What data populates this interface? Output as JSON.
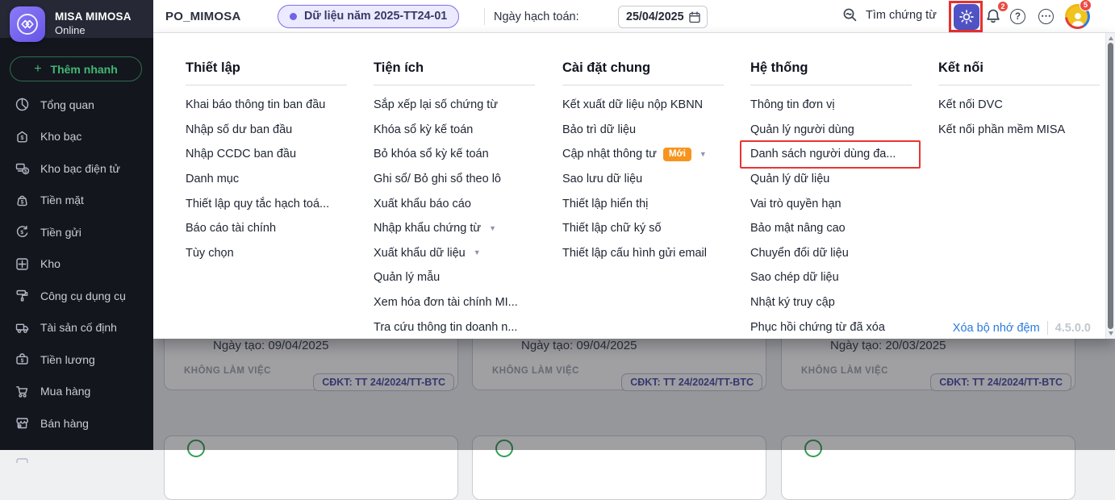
{
  "app": {
    "title": "MISA MIMOSA",
    "subtitle": "Online"
  },
  "colors": {
    "accent_purple": "#7a70ee",
    "gear_background": "#5053c4",
    "highlight_red": "#e93430",
    "notification_red": "#ec4a43",
    "badge_orange": "#f7941d",
    "link_blue": "#2a7ade",
    "success_green": "#2f9e52",
    "quick_add_green": "#40b873",
    "version_gray": "#c2c6ce"
  },
  "sidebar": {
    "quick_add_label": "Thêm nhanh",
    "items": [
      {
        "label": "Tổng quan",
        "icon": "pie-chart"
      },
      {
        "label": "Kho bạc",
        "icon": "treasury-house"
      },
      {
        "label": "Kho bạc điện tử",
        "icon": "e-treasury"
      },
      {
        "label": "Tiền mặt",
        "icon": "cash-purse"
      },
      {
        "label": "Tiền gửi",
        "icon": "deposit-cycle"
      },
      {
        "label": "Kho",
        "icon": "warehouse-grid"
      },
      {
        "label": "Công cụ dụng cụ",
        "icon": "tools-roller"
      },
      {
        "label": "Tài sản cố định",
        "icon": "asset-truck"
      },
      {
        "label": "Tiền lương",
        "icon": "salary-briefcase"
      },
      {
        "label": "Mua hàng",
        "icon": "purchase-cart"
      },
      {
        "label": "Bán hàng",
        "icon": "sales-store"
      }
    ]
  },
  "topbar": {
    "company": "PO_MIMOSA",
    "dataset_pill": "Dữ liệu năm 2025-TT24-01",
    "posting_date_label": "Ngày hạch toán:",
    "posting_date": "25/04/2025",
    "search_label": "Tìm chứng từ",
    "notification_count": "2",
    "profile_count": "5"
  },
  "menu": {
    "new_badge": "Mới",
    "columns": [
      {
        "title": "Thiết lập",
        "items": [
          "Khai báo thông tin ban đầu",
          "Nhập số dư ban đầu",
          "Nhập CCDC ban đầu",
          "Danh mục",
          "Thiết lập quy tắc hạch toá...",
          "Báo cáo tài chính",
          "Tùy chọn"
        ]
      },
      {
        "title": "Tiện ích",
        "items": [
          "Sắp xếp lại số chứng từ",
          "Khóa sổ kỳ kế toán",
          "Bỏ khóa sổ kỳ kế toán",
          "Ghi sổ/ Bỏ ghi sổ theo lô",
          "Xuất khẩu báo cáo",
          "Nhập khẩu chứng từ",
          "Xuất khẩu dữ liệu",
          "Quản lý mẫu",
          "Xem hóa đơn tài chính MI...",
          "Tra cứu thông tin doanh n..."
        ]
      },
      {
        "title": "Cài đặt chung",
        "items": [
          "Kết xuất dữ liệu nộp KBNN",
          "Bảo trì dữ liệu",
          "Cập nhật thông tư",
          "Sao lưu dữ liệu",
          "Thiết lập hiển thị",
          "Thiết lập chữ ký số",
          "Thiết lập cấu hình gửi email"
        ]
      },
      {
        "title": "Hệ thống",
        "items": [
          "Thông tin đơn vị",
          "Quản lý người dùng",
          "Danh sách người dùng đa...",
          "Quản lý dữ liệu",
          "Vai trò quyền hạn",
          "Bảo mật nâng cao",
          "Chuyển đổi dữ liệu",
          "Sao chép dữ liệu",
          "Nhật ký truy cập",
          "Phục hồi chứng từ đã xóa"
        ]
      },
      {
        "title": "Kết nối",
        "items": [
          "Kết nối DVC",
          "Kết nối phần mềm MISA"
        ]
      }
    ],
    "footer": {
      "clear_cache": "Xóa bộ nhớ đệm",
      "version": "4.5.0.0"
    }
  },
  "cards": [
    {
      "created": "Ngày tạo: 09/04/2025",
      "status": "KHÔNG LÀM VIỆC",
      "badge": "CĐKT: TT 24/2024/TT-BTC"
    },
    {
      "created": "Ngày tạo: 09/04/2025",
      "status": "KHÔNG LÀM VIỆC",
      "badge": "CĐKT: TT 24/2024/TT-BTC"
    },
    {
      "created": "Ngày tạo: 20/03/2025",
      "status": "KHÔNG LÀM VIỆC",
      "badge": "CĐKT: TT 24/2024/TT-BTC"
    }
  ]
}
